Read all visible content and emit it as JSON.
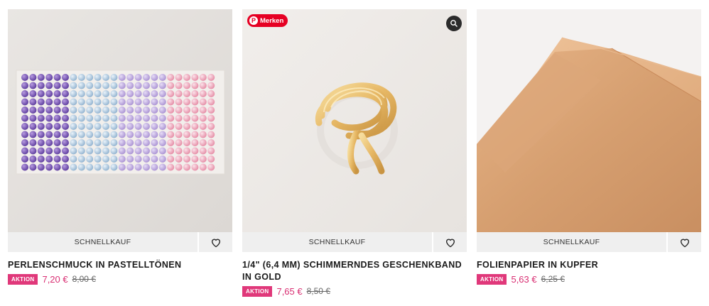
{
  "products": [
    {
      "quick_label": "SCHNELLKAUF",
      "title": "PERLENSCHMUCK IN PASTELLTÖNEN",
      "badge": "AKTION",
      "price": "7,20 €",
      "old_price": "8,00 €",
      "image": "pastel pearl embellishments on a sheet"
    },
    {
      "quick_label": "SCHNELLKAUF",
      "title": "1/4\" (6,4 MM) SCHIMMERNDES GESCHENKBAND IN GOLD",
      "badge": "AKTION",
      "price": "7,65 €",
      "old_price": "8,50 €",
      "pin_label": "Merken",
      "image": "gold shimmer ribbon bundle"
    },
    {
      "quick_label": "SCHNELLKAUF",
      "title": "FOLIENPAPIER IN KUPFER",
      "badge": "AKTION",
      "price": "5,63 €",
      "old_price": "6,25 €",
      "image": "copper foil sheets"
    }
  ],
  "colors": {
    "accent": "#e0387a",
    "price": "#d92f73",
    "pinterest": "#e60023",
    "bar": "#efefef"
  },
  "icons": {
    "favorite": "heart-icon",
    "pinterest": "pinterest-icon",
    "lens": "visual-search-icon"
  }
}
